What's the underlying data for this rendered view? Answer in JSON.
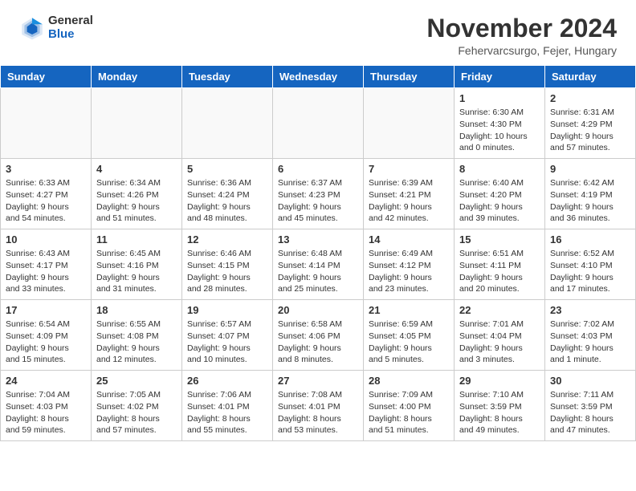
{
  "header": {
    "logo_general": "General",
    "logo_blue": "Blue",
    "month_title": "November 2024",
    "location": "Fehervarcsurgo, Fejer, Hungary"
  },
  "weekdays": [
    "Sunday",
    "Monday",
    "Tuesday",
    "Wednesday",
    "Thursday",
    "Friday",
    "Saturday"
  ],
  "weeks": [
    [
      {
        "day": "",
        "info": ""
      },
      {
        "day": "",
        "info": ""
      },
      {
        "day": "",
        "info": ""
      },
      {
        "day": "",
        "info": ""
      },
      {
        "day": "",
        "info": ""
      },
      {
        "day": "1",
        "info": "Sunrise: 6:30 AM\nSunset: 4:30 PM\nDaylight: 10 hours\nand 0 minutes."
      },
      {
        "day": "2",
        "info": "Sunrise: 6:31 AM\nSunset: 4:29 PM\nDaylight: 9 hours\nand 57 minutes."
      }
    ],
    [
      {
        "day": "3",
        "info": "Sunrise: 6:33 AM\nSunset: 4:27 PM\nDaylight: 9 hours\nand 54 minutes."
      },
      {
        "day": "4",
        "info": "Sunrise: 6:34 AM\nSunset: 4:26 PM\nDaylight: 9 hours\nand 51 minutes."
      },
      {
        "day": "5",
        "info": "Sunrise: 6:36 AM\nSunset: 4:24 PM\nDaylight: 9 hours\nand 48 minutes."
      },
      {
        "day": "6",
        "info": "Sunrise: 6:37 AM\nSunset: 4:23 PM\nDaylight: 9 hours\nand 45 minutes."
      },
      {
        "day": "7",
        "info": "Sunrise: 6:39 AM\nSunset: 4:21 PM\nDaylight: 9 hours\nand 42 minutes."
      },
      {
        "day": "8",
        "info": "Sunrise: 6:40 AM\nSunset: 4:20 PM\nDaylight: 9 hours\nand 39 minutes."
      },
      {
        "day": "9",
        "info": "Sunrise: 6:42 AM\nSunset: 4:19 PM\nDaylight: 9 hours\nand 36 minutes."
      }
    ],
    [
      {
        "day": "10",
        "info": "Sunrise: 6:43 AM\nSunset: 4:17 PM\nDaylight: 9 hours\nand 33 minutes."
      },
      {
        "day": "11",
        "info": "Sunrise: 6:45 AM\nSunset: 4:16 PM\nDaylight: 9 hours\nand 31 minutes."
      },
      {
        "day": "12",
        "info": "Sunrise: 6:46 AM\nSunset: 4:15 PM\nDaylight: 9 hours\nand 28 minutes."
      },
      {
        "day": "13",
        "info": "Sunrise: 6:48 AM\nSunset: 4:14 PM\nDaylight: 9 hours\nand 25 minutes."
      },
      {
        "day": "14",
        "info": "Sunrise: 6:49 AM\nSunset: 4:12 PM\nDaylight: 9 hours\nand 23 minutes."
      },
      {
        "day": "15",
        "info": "Sunrise: 6:51 AM\nSunset: 4:11 PM\nDaylight: 9 hours\nand 20 minutes."
      },
      {
        "day": "16",
        "info": "Sunrise: 6:52 AM\nSunset: 4:10 PM\nDaylight: 9 hours\nand 17 minutes."
      }
    ],
    [
      {
        "day": "17",
        "info": "Sunrise: 6:54 AM\nSunset: 4:09 PM\nDaylight: 9 hours\nand 15 minutes."
      },
      {
        "day": "18",
        "info": "Sunrise: 6:55 AM\nSunset: 4:08 PM\nDaylight: 9 hours\nand 12 minutes."
      },
      {
        "day": "19",
        "info": "Sunrise: 6:57 AM\nSunset: 4:07 PM\nDaylight: 9 hours\nand 10 minutes."
      },
      {
        "day": "20",
        "info": "Sunrise: 6:58 AM\nSunset: 4:06 PM\nDaylight: 9 hours\nand 8 minutes."
      },
      {
        "day": "21",
        "info": "Sunrise: 6:59 AM\nSunset: 4:05 PM\nDaylight: 9 hours\nand 5 minutes."
      },
      {
        "day": "22",
        "info": "Sunrise: 7:01 AM\nSunset: 4:04 PM\nDaylight: 9 hours\nand 3 minutes."
      },
      {
        "day": "23",
        "info": "Sunrise: 7:02 AM\nSunset: 4:03 PM\nDaylight: 9 hours\nand 1 minute."
      }
    ],
    [
      {
        "day": "24",
        "info": "Sunrise: 7:04 AM\nSunset: 4:03 PM\nDaylight: 8 hours\nand 59 minutes."
      },
      {
        "day": "25",
        "info": "Sunrise: 7:05 AM\nSunset: 4:02 PM\nDaylight: 8 hours\nand 57 minutes."
      },
      {
        "day": "26",
        "info": "Sunrise: 7:06 AM\nSunset: 4:01 PM\nDaylight: 8 hours\nand 55 minutes."
      },
      {
        "day": "27",
        "info": "Sunrise: 7:08 AM\nSunset: 4:01 PM\nDaylight: 8 hours\nand 53 minutes."
      },
      {
        "day": "28",
        "info": "Sunrise: 7:09 AM\nSunset: 4:00 PM\nDaylight: 8 hours\nand 51 minutes."
      },
      {
        "day": "29",
        "info": "Sunrise: 7:10 AM\nSunset: 3:59 PM\nDaylight: 8 hours\nand 49 minutes."
      },
      {
        "day": "30",
        "info": "Sunrise: 7:11 AM\nSunset: 3:59 PM\nDaylight: 8 hours\nand 47 minutes."
      }
    ]
  ]
}
